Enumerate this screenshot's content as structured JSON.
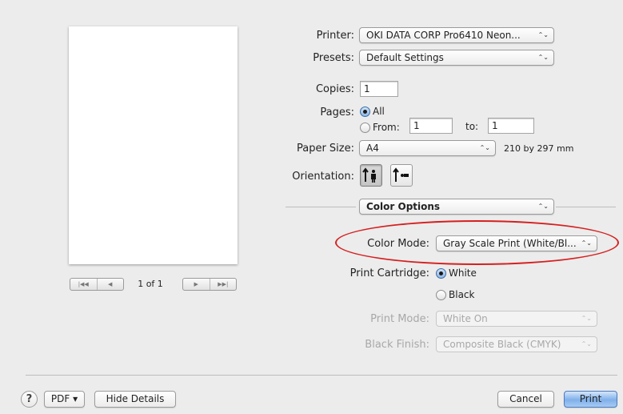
{
  "preview": {
    "page_indicator": "1 of 1"
  },
  "printer": {
    "label": "Printer:",
    "value": "OKI DATA CORP Pro6410 Neon..."
  },
  "presets": {
    "label": "Presets:",
    "value": "Default Settings"
  },
  "copies": {
    "label": "Copies:",
    "value": "1"
  },
  "pages": {
    "label": "Pages:",
    "all_label": "All",
    "from_label": "From:",
    "from_value": "1",
    "to_label": "to:",
    "to_value": "1",
    "selected": "All"
  },
  "paper_size": {
    "label": "Paper Size:",
    "value": "A4",
    "dimensions": "210 by 297 mm"
  },
  "orientation": {
    "label": "Orientation:",
    "selected": "portrait"
  },
  "panel": {
    "value": "Color Options"
  },
  "color_mode": {
    "label": "Color Mode:",
    "value": "Gray Scale Print (White/Bl..."
  },
  "print_cartridge": {
    "label": "Print Cartridge:",
    "options": [
      "White",
      "Black"
    ],
    "selected": "White"
  },
  "print_mode": {
    "label": "Print Mode:",
    "value": "White On"
  },
  "black_finish": {
    "label": "Black Finish:",
    "value": "Composite Black (CMYK)"
  },
  "bottom": {
    "help": "?",
    "pdf_label": "PDF ▾",
    "hide_details_label": "Hide Details",
    "cancel_label": "Cancel",
    "print_label": "Print"
  },
  "icons": {
    "popup_arrows": "⌃⌄",
    "first": "|◀◀",
    "prev": "◀",
    "next": "▶",
    "last": "▶▶|"
  },
  "colors": {
    "highlight_ellipse": "#d62020",
    "default_button": "#7fb0ea"
  }
}
